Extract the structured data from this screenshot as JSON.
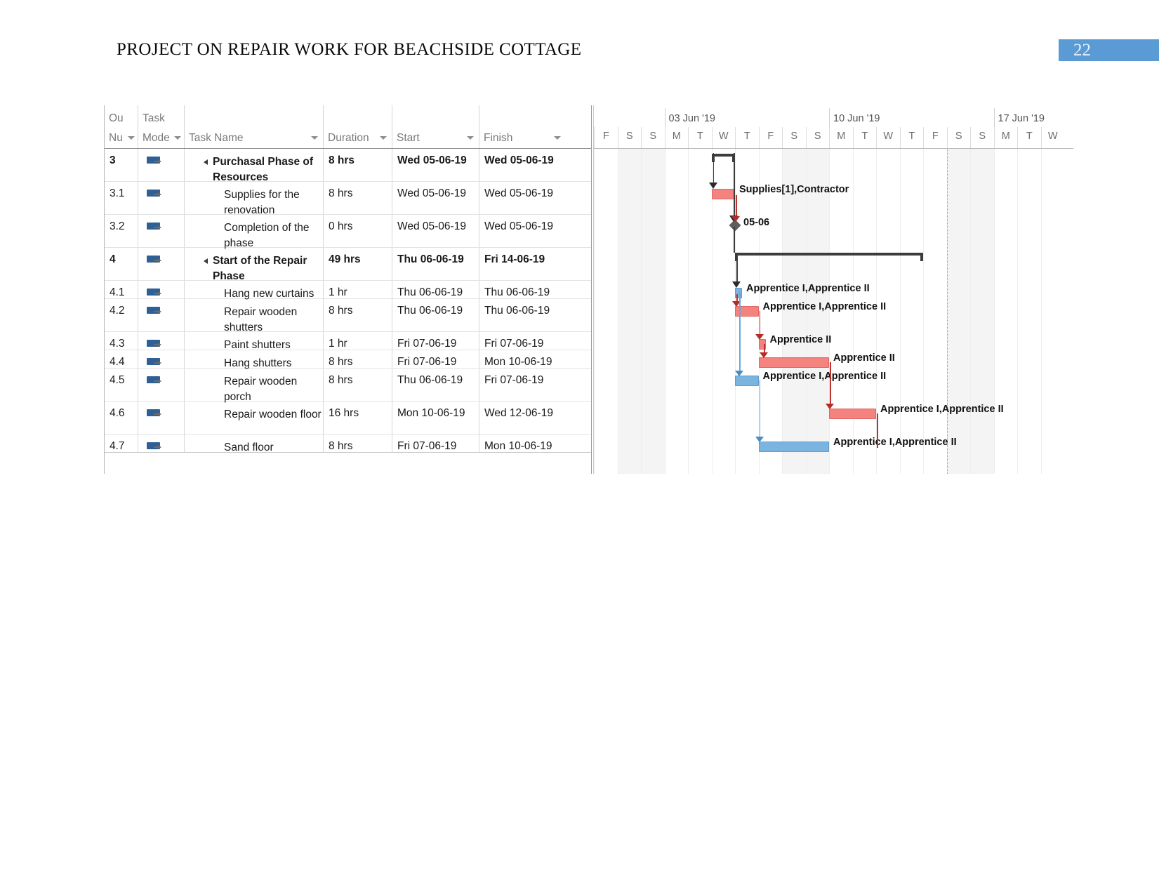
{
  "document": {
    "title": "PROJECT ON REPAIR WORK FOR BEACHSIDE COTTAGE",
    "page_number": "22",
    "accent_color": "#5b9bd5"
  },
  "table": {
    "headers": {
      "outline_number_line1": "Ou",
      "outline_number_line2": "Nu",
      "task_mode_line1": "Task",
      "task_mode_line2": "Mode",
      "task_name": "Task Name",
      "duration": "Duration",
      "start": "Start",
      "finish": "Finish"
    },
    "rows": [
      {
        "num": "3",
        "mode_icon": "auto-schedule-icon",
        "name": "Purchasal Phase of Resources",
        "duration": "8 hrs",
        "start": "Wed 05-06-19",
        "finish": "Wed 05-06-19",
        "level": 1,
        "summary": true
      },
      {
        "num": "3.1",
        "mode_icon": "auto-schedule-icon",
        "name": "Supplies for the renovation",
        "duration": "8 hrs",
        "start": "Wed 05-06-19",
        "finish": "Wed 05-06-19",
        "level": 2,
        "summary": false
      },
      {
        "num": "3.2",
        "mode_icon": "auto-schedule-icon",
        "name": "Completion of the phase",
        "duration": "0 hrs",
        "start": "Wed 05-06-19",
        "finish": "Wed 05-06-19",
        "level": 2,
        "summary": false
      },
      {
        "num": "4",
        "mode_icon": "auto-schedule-icon",
        "name": "Start of the Repair Phase",
        "duration": "49 hrs",
        "start": "Thu 06-06-19",
        "finish": "Fri 14-06-19",
        "level": 1,
        "summary": true
      },
      {
        "num": "4.1",
        "mode_icon": "auto-schedule-icon",
        "name": "Hang new curtains",
        "duration": "1 hr",
        "start": "Thu 06-06-19",
        "finish": "Thu 06-06-19",
        "level": 2,
        "summary": false
      },
      {
        "num": "4.2",
        "mode_icon": "auto-schedule-icon",
        "name": "Repair wooden shutters",
        "duration": "8 hrs",
        "start": "Thu 06-06-19",
        "finish": "Thu 06-06-19",
        "level": 2,
        "summary": false
      },
      {
        "num": "4.3",
        "mode_icon": "auto-schedule-icon",
        "name": "Paint shutters",
        "duration": "1 hr",
        "start": "Fri 07-06-19",
        "finish": "Fri 07-06-19",
        "level": 2,
        "summary": false
      },
      {
        "num": "4.4",
        "mode_icon": "auto-schedule-icon",
        "name": "Hang shutters",
        "duration": "8 hrs",
        "start": "Fri 07-06-19",
        "finish": "Mon 10-06-19",
        "level": 2,
        "summary": false
      },
      {
        "num": "4.5",
        "mode_icon": "auto-schedule-icon",
        "name": "Repair wooden porch",
        "duration": "8 hrs",
        "start": "Thu 06-06-19",
        "finish": "Fri 07-06-19",
        "level": 2,
        "summary": false
      },
      {
        "num": "4.6",
        "mode_icon": "auto-schedule-icon",
        "name": "Repair wooden floor",
        "duration": "16 hrs",
        "start": "Mon 10-06-19",
        "finish": "Wed 12-06-19",
        "level": 2,
        "summary": false
      },
      {
        "num": "4.7",
        "mode_icon": "auto-schedule-icon",
        "name": "Sand floor",
        "duration": "8 hrs",
        "start": "Fri 07-06-19",
        "finish": "Mon 10-06-19",
        "level": 2,
        "summary": false
      }
    ]
  },
  "timeline": {
    "week_labels": [
      "03 Jun '19",
      "10 Jun '19",
      "17 Jun '19"
    ],
    "days": [
      "F",
      "S",
      "S",
      "M",
      "T",
      "W",
      "T",
      "F",
      "S",
      "S",
      "M",
      "T",
      "W",
      "T",
      "F",
      "S",
      "S",
      "M",
      "T",
      "W"
    ],
    "weekend_indices": [
      1,
      2,
      8,
      9,
      15,
      16
    ],
    "today_index": 15
  },
  "chart_data": {
    "type": "bar",
    "title": "Gantt chart for Purchasal Phase and Repair Phase",
    "xlabel": "",
    "ylabel": "",
    "bars": [
      {
        "row": "3",
        "task": "Purchasal Phase of Resources",
        "kind": "summary",
        "start_day_index": 5,
        "end_day_index": 6,
        "label": ""
      },
      {
        "row": "3.1",
        "task": "Supplies for the renovation",
        "kind": "task-red",
        "start_day_index": 5,
        "end_day_index": 6,
        "label": "Supplies[1],Contractor"
      },
      {
        "row": "3.2",
        "task": "Completion of the phase",
        "kind": "milestone",
        "start_day_index": 6,
        "end_day_index": 6,
        "label": "05-06"
      },
      {
        "row": "4",
        "task": "Start of the Repair Phase",
        "kind": "summary",
        "start_day_index": 6,
        "end_day_index": 14,
        "label": ""
      },
      {
        "row": "4.1",
        "task": "Hang new curtains",
        "kind": "task-blue",
        "start_day_index": 6,
        "end_day_index": 6.2,
        "label": "Apprentice I,Apprentice II"
      },
      {
        "row": "4.2",
        "task": "Repair wooden shutters",
        "kind": "task-red",
        "start_day_index": 6,
        "end_day_index": 7,
        "label": "Apprentice I,Apprentice II"
      },
      {
        "row": "4.3",
        "task": "Paint shutters",
        "kind": "task-red",
        "start_day_index": 7,
        "end_day_index": 7.2,
        "label": "Apprentice II"
      },
      {
        "row": "4.4",
        "task": "Hang shutters",
        "kind": "task-red",
        "start_day_index": 7,
        "end_day_index": 10,
        "label": "Apprentice II"
      },
      {
        "row": "4.5",
        "task": "Repair wooden porch",
        "kind": "task-blue",
        "start_day_index": 6,
        "end_day_index": 7,
        "label": "Apprentice I,Apprentice II"
      },
      {
        "row": "4.6",
        "task": "Repair wooden floor",
        "kind": "task-red",
        "start_day_index": 10,
        "end_day_index": 12,
        "label": "Apprentice I,Apprentice II"
      },
      {
        "row": "4.7",
        "task": "Sand floor",
        "kind": "task-blue",
        "start_day_index": 7,
        "end_day_index": 10,
        "label": "Apprentice I,Apprentice II"
      }
    ]
  }
}
